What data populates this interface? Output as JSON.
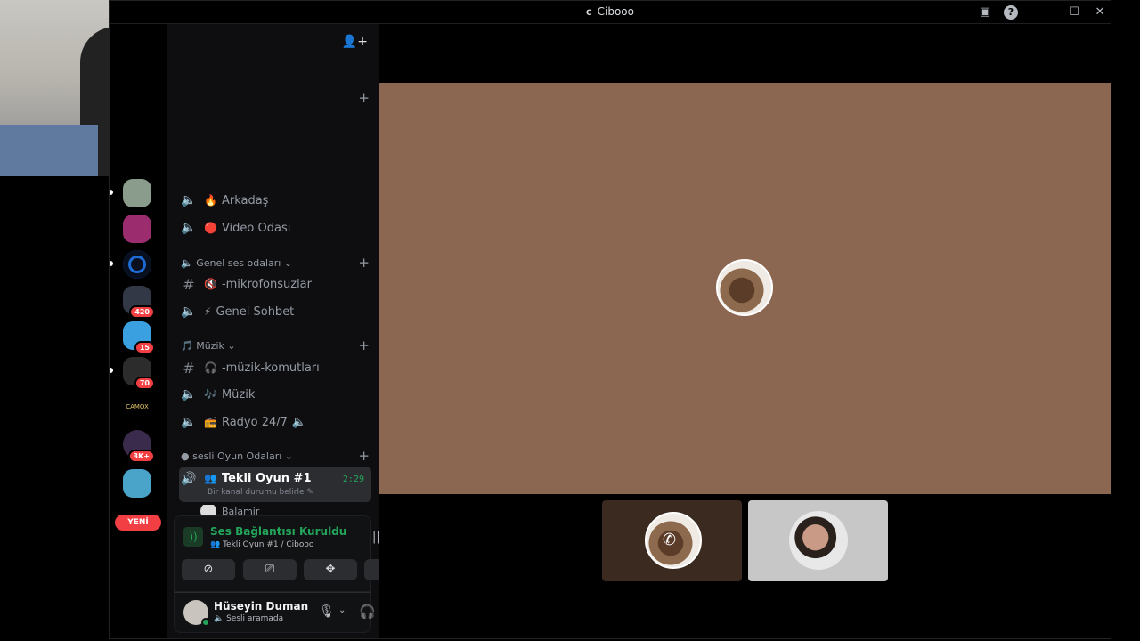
{
  "window": {
    "title": "Ciboоо",
    "title_icon": "C"
  },
  "titlebar_icons": [
    "inbox-icon",
    "help-icon",
    "minimize-icon",
    "maximize-icon",
    "close-icon"
  ],
  "channels": {
    "items_top": [
      {
        "name": "Arkadaş",
        "emoji": "🔥"
      },
      {
        "name": "Video Odası",
        "emoji": "🔴"
      }
    ],
    "categories": [
      {
        "label": "Genel ses odaları",
        "icon": "🔈",
        "channels": [
          {
            "name": "-mikrofonsuzlar",
            "emoji": "🔇",
            "type": "text"
          },
          {
            "name": "Genel Sohbet",
            "emoji": "⚡",
            "type": "voice"
          }
        ]
      },
      {
        "label": "Müzik",
        "icon": "🎵",
        "channels": [
          {
            "name": "-müzik-komutları",
            "emoji": "🎧",
            "type": "text"
          },
          {
            "name": "Müzik",
            "emoji": "🎶",
            "type": "voice"
          },
          {
            "name": "Radyo 24/7",
            "emoji": "📻",
            "type": "voice"
          }
        ]
      },
      {
        "label": "sesli Oyun Odaları",
        "icon": "●",
        "channels": [
          {
            "name": "Tekli Oyun #1",
            "emoji": "👥",
            "type": "voice",
            "timer": "2:29",
            "status": "Bir kanal durumu belirle"
          }
        ]
      }
    ],
    "member_preview": "Balamir"
  },
  "servers": {
    "badges": [
      "420",
      "15",
      "70",
      "3K+"
    ],
    "new_label": "YENİ"
  },
  "voice_panel": {
    "status": "Ses Bağlantısı Kuruldu",
    "location": "Tekli Oyun #1 / Ciboоо"
  },
  "user": {
    "name": "Hüseyin Duman",
    "status": "Sesli aramada"
  },
  "colors": {
    "stage_bg": "#8b6650",
    "connected_green": "#23a55a",
    "badge_red": "#f23f43"
  }
}
